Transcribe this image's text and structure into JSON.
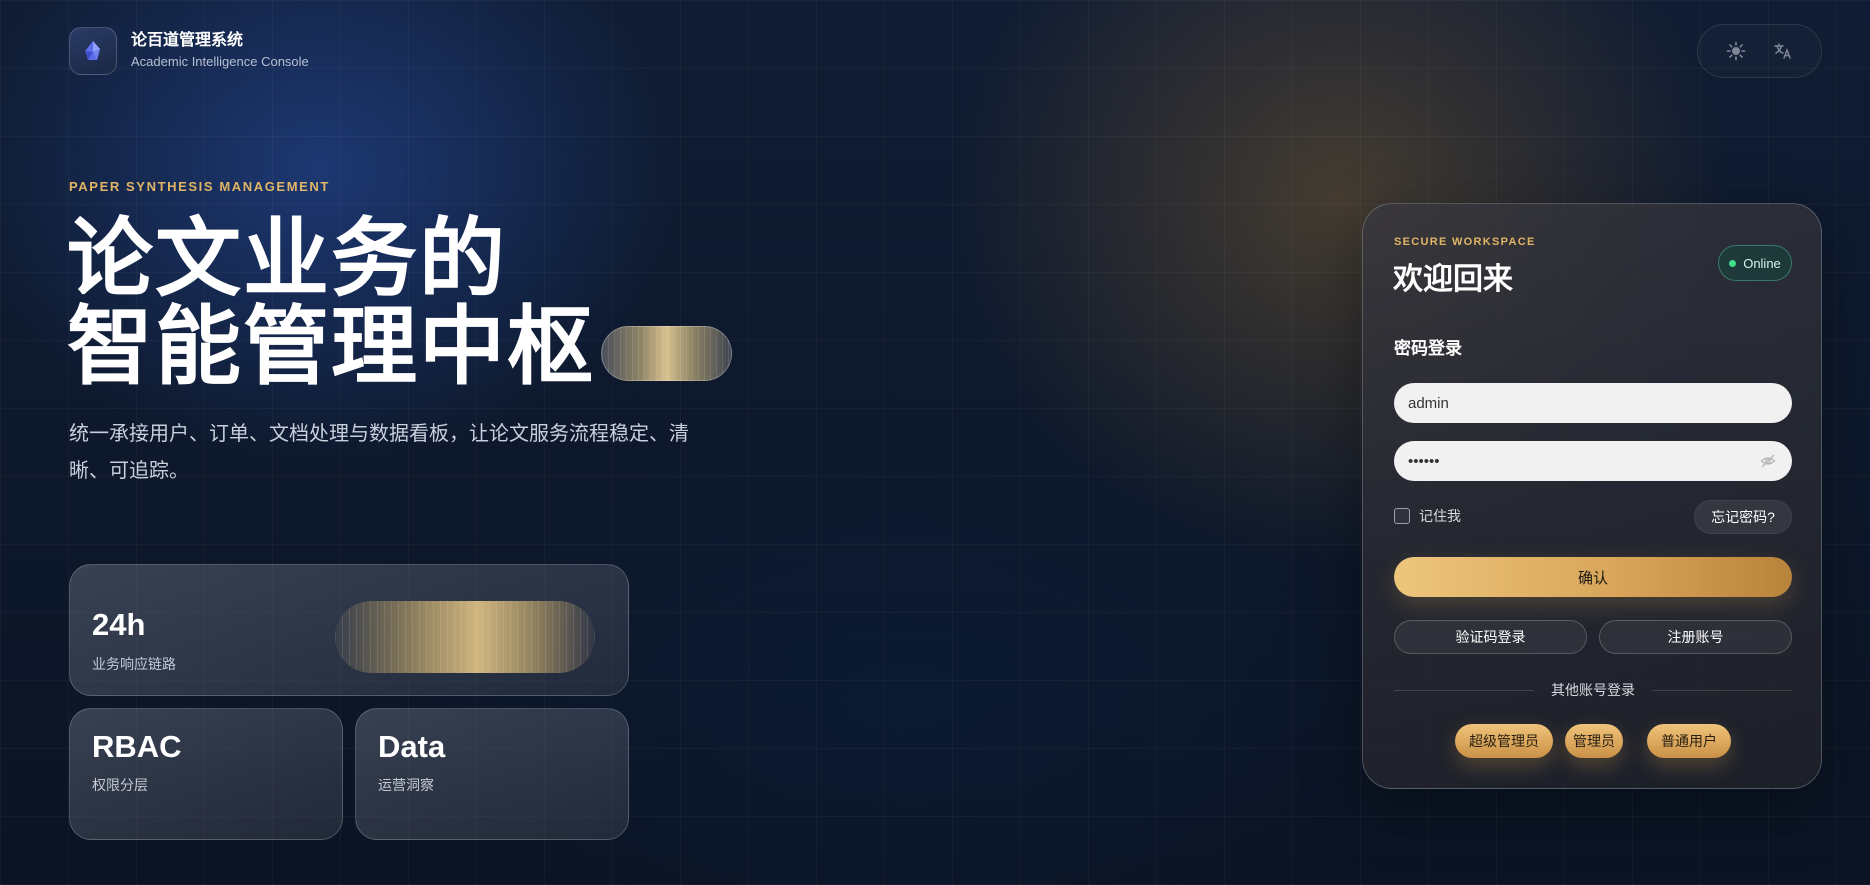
{
  "brand": {
    "title": "论百道管理系统",
    "subtitle": "Academic Intelligence Console",
    "logo_icon": "crystal-logo-icon"
  },
  "controls": {
    "theme_icon": "sun-icon",
    "language_icon": "translate-icon"
  },
  "hero": {
    "eyebrow": "PAPER SYNTHESIS MANAGEMENT",
    "title_line1": "论文业务的",
    "title_line2": "智能管理中枢",
    "description": "统一承接用户、订单、文档处理与数据看板，让论文服务流程稳定、清晰、可追踪。"
  },
  "stats": [
    {
      "value": "24h",
      "label": "业务响应链路"
    },
    {
      "value": "RBAC",
      "label": "权限分层"
    },
    {
      "value": "Data",
      "label": "运营洞察"
    }
  ],
  "login": {
    "eyebrow": "SECURE WORKSPACE",
    "title": "欢迎回来",
    "status": "Online",
    "section_title": "密码登录",
    "username_value": "admin",
    "password_value": "••••••",
    "remember_label": "记住我",
    "forgot_label": "忘记密码?",
    "confirm_label": "确认",
    "sms_login_label": "验证码登录",
    "register_label": "注册账号",
    "other_accounts_label": "其他账号登录",
    "accounts": [
      "超级管理员",
      "管理员",
      "普通用户"
    ]
  },
  "colors": {
    "accent_gold": "#e1b566",
    "status_green": "#3fe08a",
    "background": "#0d182b"
  }
}
